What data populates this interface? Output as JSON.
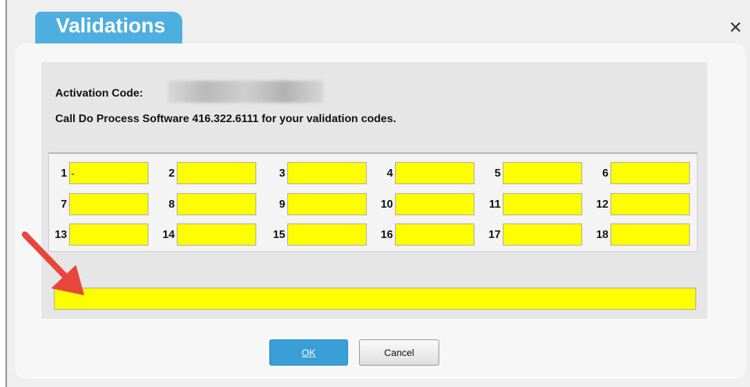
{
  "dialog": {
    "title": "Validations",
    "close_glyph": "✕"
  },
  "activation": {
    "label": "Activation Code:",
    "value_redacted": true
  },
  "instructions": "Call Do Process Software 416.322.6111 for your validation codes.",
  "codes": [
    {
      "label": "1",
      "value": "-"
    },
    {
      "label": "2",
      "value": ""
    },
    {
      "label": "3",
      "value": ""
    },
    {
      "label": "4",
      "value": ""
    },
    {
      "label": "5",
      "value": ""
    },
    {
      "label": "6",
      "value": ""
    },
    {
      "label": "7",
      "value": ""
    },
    {
      "label": "8",
      "value": ""
    },
    {
      "label": "9",
      "value": ""
    },
    {
      "label": "10",
      "value": ""
    },
    {
      "label": "11",
      "value": ""
    },
    {
      "label": "12",
      "value": ""
    },
    {
      "label": "13",
      "value": ""
    },
    {
      "label": "14",
      "value": ""
    },
    {
      "label": "15",
      "value": ""
    },
    {
      "label": "16",
      "value": ""
    },
    {
      "label": "17",
      "value": ""
    },
    {
      "label": "18",
      "value": ""
    }
  ],
  "combined_code_field": {
    "value": ""
  },
  "buttons": {
    "ok_label": "OK",
    "cancel_label": "Cancel"
  },
  "colors": {
    "title_tab": "#4eaee0",
    "field_fill": "#ffff00",
    "ok_button": "#3a9fd6",
    "annotation_arrow": "#e8453c"
  },
  "icons": {
    "close": "close-icon",
    "annotation": "arrow-annotation-icon"
  }
}
